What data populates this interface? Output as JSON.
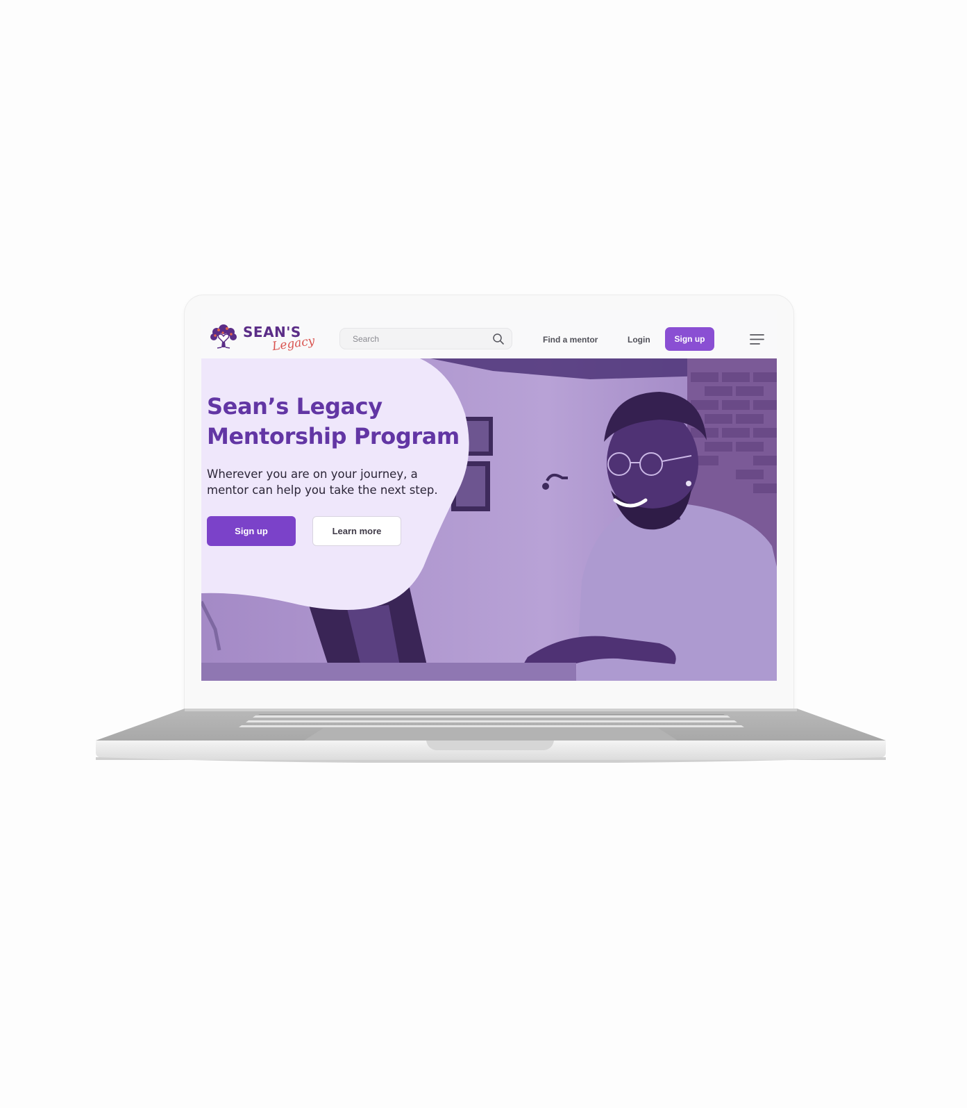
{
  "brand": {
    "name_main": "SEAN'S",
    "name_script": "Legacy"
  },
  "nav": {
    "search_placeholder": "Search",
    "find_mentor_label": "Find a mentor",
    "login_label": "Login",
    "signup_label": "Sign up"
  },
  "hero": {
    "title": "Sean’s Legacy Mentorship Program",
    "subtitle": "Wherever you are on your journey, a mentor can help you take the next step.",
    "primary_button_label": "Sign up",
    "secondary_button_label": "Learn more"
  },
  "colors": {
    "accent": "#8a4fd3",
    "primary_button": "#7b42c9",
    "heading": "#6236a4",
    "hero_panel": "#efe7fb",
    "photo_tint": "#a58ccc",
    "logo_text": "#5b2d87",
    "logo_script": "#d9534f"
  },
  "icons": {
    "logo": "tree-heart-icon",
    "search": "search-icon",
    "menu": "hamburger-menu-icon"
  }
}
